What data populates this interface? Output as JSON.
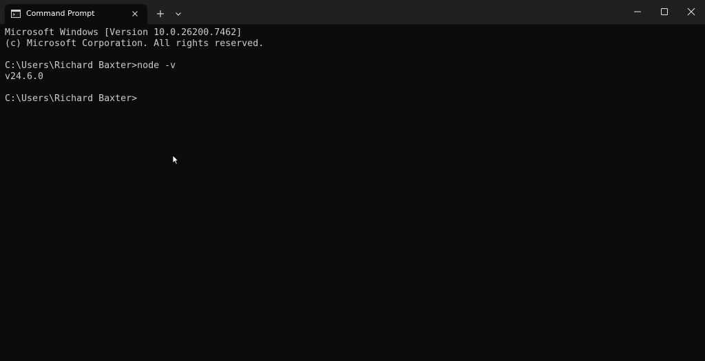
{
  "window": {
    "tab_title": "Command Prompt",
    "icons": {
      "tab": "console-icon",
      "tab_close": "close-icon",
      "new_tab": "plus-icon",
      "dropdown": "chevron-down-icon",
      "minimize": "minimize-icon",
      "maximize": "maximize-icon",
      "close": "close-icon"
    },
    "colors": {
      "titlebar": "#202020",
      "background": "#0c0c0c",
      "text": "#cccccc"
    }
  },
  "console": {
    "lines": [
      "Microsoft Windows [Version 10.0.26200.7462]",
      "(c) Microsoft Corporation. All rights reserved.",
      "",
      "C:\\Users\\Richard Baxter>node -v",
      "v24.6.0",
      "",
      "C:\\Users\\Richard Baxter>"
    ]
  }
}
